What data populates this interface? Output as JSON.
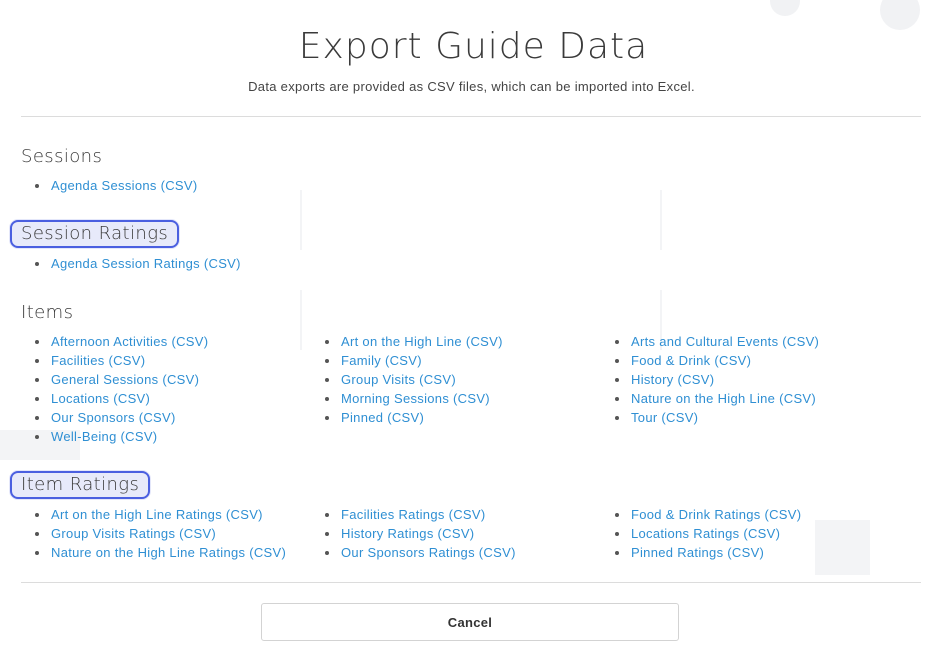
{
  "modal": {
    "title": "Export Guide Data",
    "subtitle": "Data exports are provided as CSV files, which can be imported into Excel.",
    "cancel_label": "Cancel"
  },
  "sections": {
    "sessions": {
      "heading": "Sessions",
      "links": [
        "Agenda Sessions (CSV)"
      ]
    },
    "session_ratings": {
      "heading": "Session Ratings",
      "highlighted": true,
      "links": [
        "Agenda Session Ratings (CSV)"
      ]
    },
    "items": {
      "heading": "Items",
      "columns": [
        [
          "Afternoon Activities (CSV)",
          "Facilities (CSV)",
          "General Sessions (CSV)",
          "Locations (CSV)",
          "Our Sponsors (CSV)",
          "Well-Being (CSV)"
        ],
        [
          "Art on the High Line (CSV)",
          "Family (CSV)",
          "Group Visits (CSV)",
          "Morning Sessions (CSV)",
          "Pinned (CSV)"
        ],
        [
          "Arts and Cultural Events (CSV)",
          "Food & Drink (CSV)",
          "History (CSV)",
          "Nature on the High Line (CSV)",
          "Tour (CSV)"
        ]
      ]
    },
    "item_ratings": {
      "heading": "Item Ratings",
      "highlighted": true,
      "columns": [
        [
          "Art on the High Line Ratings (CSV)",
          "Group Visits Ratings (CSV)",
          "Nature on the High Line Ratings (CSV)"
        ],
        [
          "Facilities Ratings (CSV)",
          "History Ratings (CSV)",
          "Our Sponsors Ratings (CSV)"
        ],
        [
          "Food & Drink Ratings (CSV)",
          "Locations Ratings (CSV)",
          "Pinned Ratings (CSV)"
        ]
      ]
    }
  },
  "colors": {
    "link": "#2f8fd3",
    "highlight_border": "#4a5fe0",
    "highlight_fill": "#e7eafa"
  }
}
